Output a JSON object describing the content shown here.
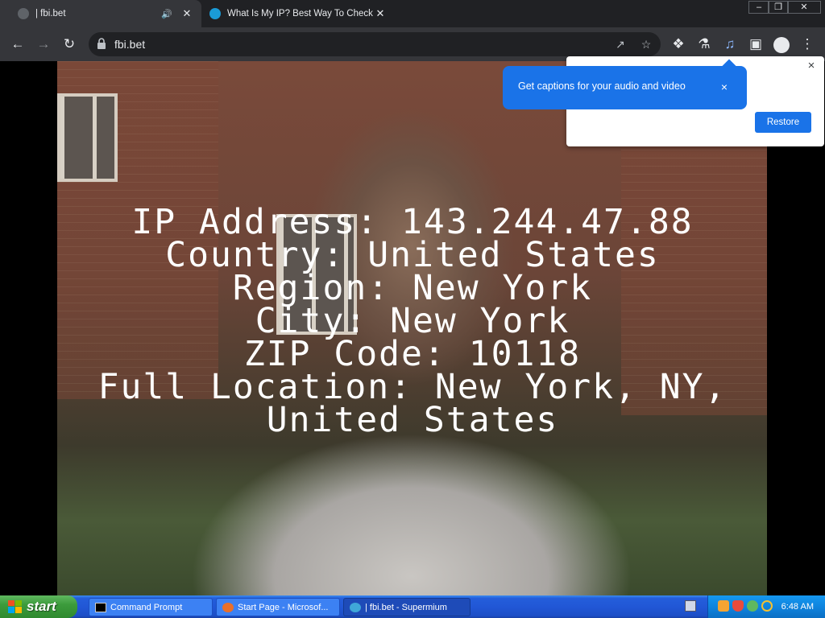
{
  "browser": {
    "tabs": [
      {
        "title": "| fbi.bet",
        "active": true,
        "audio": true
      },
      {
        "title": "What Is My IP? Best Way To Check",
        "active": false
      }
    ],
    "url": "fbi.bet"
  },
  "overlay_lines": [
    "IP Address: 143.244.47.88",
    "Country: United States",
    "Region: New York",
    "City: New York",
    "ZIP Code: 10118",
    "Full Location: New York, NY,",
    "United States"
  ],
  "captions_iph": {
    "text": "Get captions for your audio and video",
    "close_label": "×"
  },
  "restore_panel": {
    "button": "Restore",
    "close_label": "×"
  },
  "taskbar": {
    "start_label": "start",
    "buttons": [
      {
        "label": "Command Prompt"
      },
      {
        "label": "Start Page - Microsof..."
      },
      {
        "label": "| fbi.bet - Supermium"
      }
    ],
    "clock": "6:48 AM"
  },
  "colors": {
    "accent": "#1a73e8",
    "tabbar": "#202124",
    "toolbar": "#35363a",
    "taskbar": "#245edb",
    "start": "#3c9b3c"
  }
}
